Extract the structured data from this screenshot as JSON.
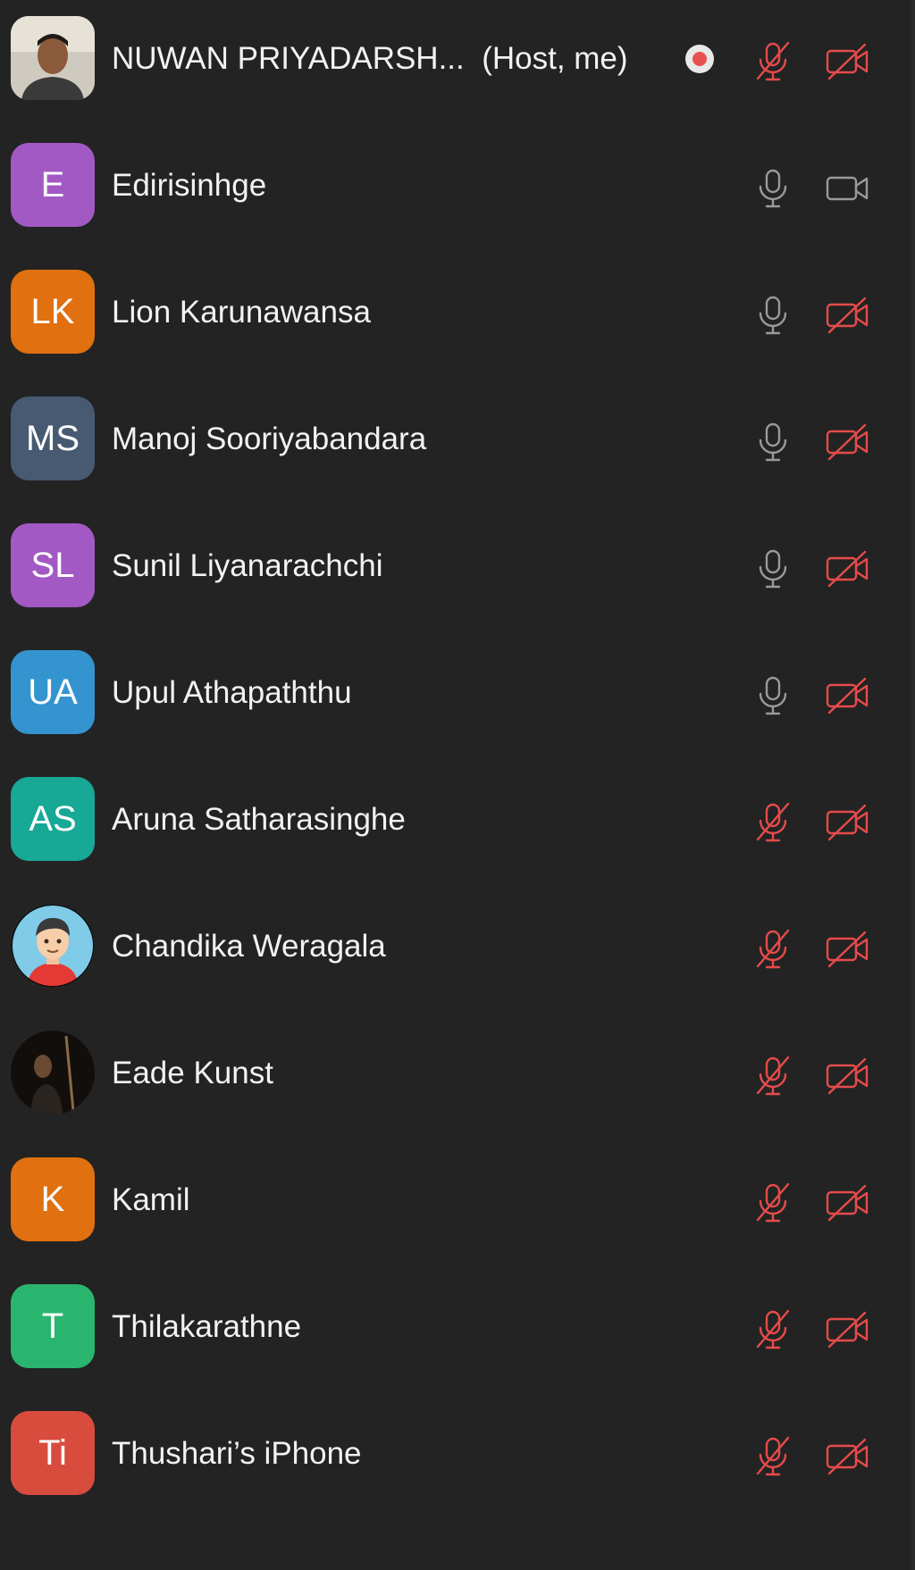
{
  "colors": {
    "background": "#232323",
    "muted_red": "#e64b4b",
    "icon_gray": "#9a9a9a",
    "recording_red": "#e85050"
  },
  "participants": [
    {
      "name": "NUWAN PRIYADARSH...  (Host, me)",
      "avatar_type": "photo",
      "avatar_desc": "man-photo",
      "recording": true,
      "mic": "muted",
      "video": "off"
    },
    {
      "name": "Edirisinhge",
      "initials": "E",
      "avatar_color": "#a259c4",
      "mic": "on",
      "video": "on"
    },
    {
      "name": "Lion Karunawansa",
      "initials": "LK",
      "avatar_color": "#e07010",
      "mic": "on",
      "video": "off"
    },
    {
      "name": "Manoj Sooriyabandara",
      "initials": "MS",
      "avatar_color": "#475a72",
      "mic": "on",
      "video": "off"
    },
    {
      "name": "Sunil Liyanarachchi",
      "initials": "SL",
      "avatar_color": "#a259c4",
      "mic": "on",
      "video": "off"
    },
    {
      "name": "Upul Athapaththu",
      "initials": "UA",
      "avatar_color": "#3494cf",
      "mic": "on",
      "video": "off"
    },
    {
      "name": "Aruna Satharasinghe",
      "initials": "AS",
      "avatar_color": "#18a896",
      "mic": "muted",
      "video": "off"
    },
    {
      "name": "Chandika Weragala",
      "avatar_type": "photo",
      "avatar_desc": "cartoon-avatar",
      "mic": "muted",
      "video": "off"
    },
    {
      "name": "Eade Kunst",
      "avatar_type": "photo",
      "avatar_desc": "dark-photo",
      "mic": "muted",
      "video": "off"
    },
    {
      "name": "Kamil",
      "initials": "K",
      "avatar_color": "#e07010",
      "mic": "muted",
      "video": "off"
    },
    {
      "name": "Thilakarathne",
      "initials": "T",
      "avatar_color": "#2ab56e",
      "mic": "muted",
      "video": "off"
    },
    {
      "name": "Thushari’s iPhone",
      "initials": "Ti",
      "avatar_color": "#d84c3e",
      "mic": "muted",
      "video": "off"
    }
  ]
}
